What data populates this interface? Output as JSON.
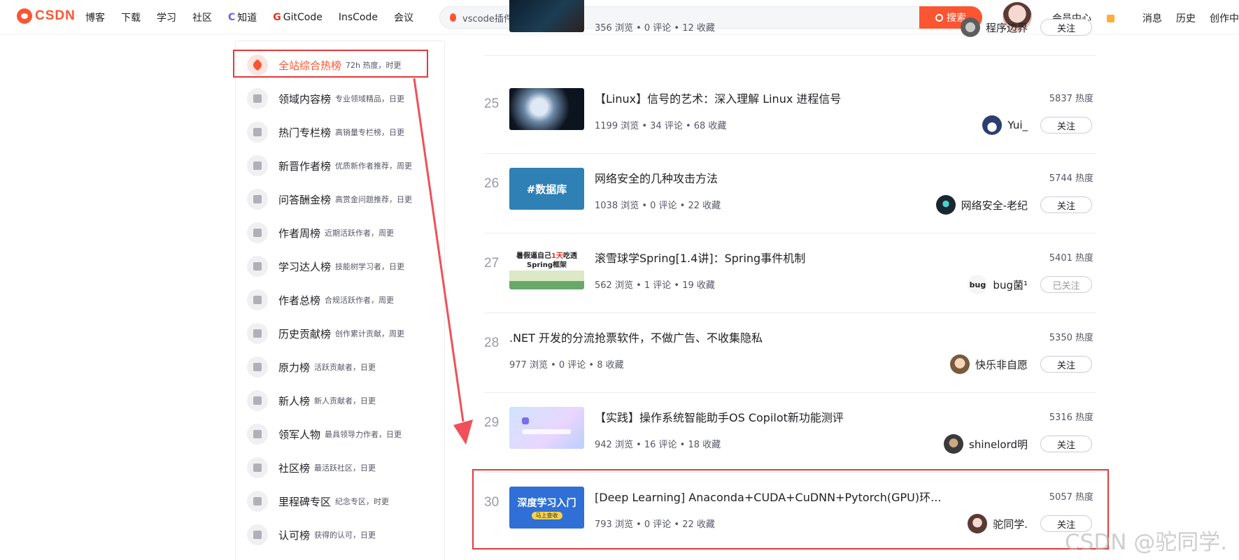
{
  "header": {
    "logo_text": "CSDN",
    "nav": [
      {
        "label": "博客",
        "icon": ""
      },
      {
        "label": "下载",
        "icon": ""
      },
      {
        "label": "学习",
        "icon": ""
      },
      {
        "label": "社区",
        "icon": ""
      },
      {
        "label": "知道",
        "icon": "C"
      },
      {
        "label": "GitCode",
        "icon": "G"
      },
      {
        "label": "InsCode",
        "icon": ""
      },
      {
        "label": "会议",
        "icon": ""
      }
    ],
    "search_value": "vscode插件",
    "search_button": "搜索",
    "right_links": [
      "会员中心",
      "消息",
      "历史",
      "创作中心"
    ]
  },
  "sidebar": {
    "items": [
      {
        "name": "全站综合热榜",
        "desc": "72h 热度，时更",
        "active": true,
        "icon": "rocket-icon"
      },
      {
        "name": "领域内容榜",
        "desc": "专业领域精品，日更",
        "icon": "code-icon"
      },
      {
        "name": "热门专栏榜",
        "desc": "高销量专栏榜，日更",
        "icon": "bookmark-icon"
      },
      {
        "name": "新晋作者榜",
        "desc": "优质新作者推荐，周更",
        "icon": "user-icon"
      },
      {
        "name": "问答酬金榜",
        "desc": "高赏金问题推荐，日更",
        "icon": "question-icon"
      },
      {
        "name": "作者周榜",
        "desc": "近期活跃作者，周更",
        "icon": "calendar-icon"
      },
      {
        "name": "学习达人榜",
        "desc": "技能树学习者，日更",
        "icon": "medal-icon"
      },
      {
        "name": "作者总榜",
        "desc": "合规活跃作者，周更",
        "icon": "trophy-icon"
      },
      {
        "name": "历史贡献榜",
        "desc": "创作累计贡献，周更",
        "icon": "podium-icon"
      },
      {
        "name": "原力榜",
        "desc": "活跃贡献者，日更",
        "icon": "force-icon"
      },
      {
        "name": "新人榜",
        "desc": "新人贡献者，日更",
        "icon": "newbie-icon"
      },
      {
        "name": "领军人物",
        "desc": "最具领导力作者，日更",
        "icon": "leader-icon"
      },
      {
        "name": "社区榜",
        "desc": "最活跃社区，日更",
        "icon": "community-icon"
      },
      {
        "name": "里程碑专区",
        "desc": "纪念专区，时更",
        "icon": "milestone-icon"
      },
      {
        "name": "认可榜",
        "desc": "获得的认可，日更",
        "icon": "approval-icon"
      }
    ]
  },
  "list": [
    {
      "rank": "",
      "title": "",
      "stats": "356 浏览 • 0 评论 • 12 收藏",
      "heat": "",
      "author": "程序边界",
      "follow": "关注",
      "thumb": "dark",
      "avatar": "cat"
    },
    {
      "rank": "25",
      "title": "【Linux】信号的艺术：深入理解 Linux 进程信号",
      "stats": "1199 浏览 • 34 评论 • 68 收藏",
      "heat": "5837 热度",
      "author": "Yui_",
      "follow": "关注",
      "thumb": "anime",
      "avatar": "penguin"
    },
    {
      "rank": "26",
      "title": "网络安全的几种攻击方法",
      "stats": "1038 浏览 • 0 评论 • 22 收藏",
      "heat": "5744 热度",
      "author": "网络安全-老纪",
      "follow": "关注",
      "thumb": "db",
      "thumb_text": "#数据库",
      "avatar": "hacker"
    },
    {
      "rank": "27",
      "title": "滚雪球学Spring[1.4讲]：Spring事件机制",
      "stats": "562 浏览 • 1 评论 • 19 收藏",
      "heat": "5401 热度",
      "author": "bug菌¹",
      "follow": "已关注",
      "thumb": "spring",
      "thumb_line1_a": "暑假逼自己",
      "thumb_line1_b": "1天",
      "thumb_line1_c": "吃透",
      "thumb_line2": "Spring框架",
      "avatar": "bug",
      "avatar_text": "bug"
    },
    {
      "rank": "28",
      "title": ".NET 开发的分流抢票软件，不做广告、不收集隐私",
      "stats": "977 浏览 • 0 评论 • 8 收藏",
      "heat": "5350 热度",
      "author": "快乐非自愿",
      "follow": "关注",
      "thumb": "",
      "avatar": "glasses"
    },
    {
      "rank": "29",
      "title": "【实践】操作系统智能助手OS Copilot新功能测评",
      "stats": "942 浏览 • 16 评论 • 18 收藏",
      "heat": "5316 热度",
      "author": "shinelord明",
      "follow": "关注",
      "thumb": "copilot",
      "avatar": "shine"
    },
    {
      "rank": "30",
      "title": "[Deep Learning] Anaconda+CUDA+CuDNN+Pytorch(GPU)环...",
      "stats": "793 浏览 • 0 评论 • 22 收藏",
      "heat": "5057 热度",
      "author": "驼同学.",
      "follow": "关注",
      "thumb": "deep",
      "thumb_text": "深度学习入门",
      "thumb_sub": "马上查收",
      "avatar": "girl"
    }
  ],
  "watermark": "CSDN @驼同学.",
  "colors": {
    "brand": "#fc5531",
    "highlight_box": "#e4393c",
    "arrow": "#f0505a"
  }
}
